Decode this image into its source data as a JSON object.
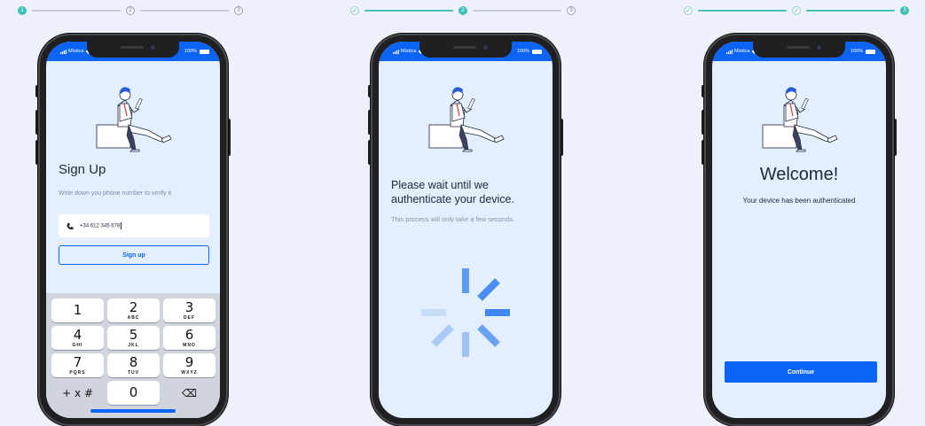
{
  "steppers": [
    {
      "steps": [
        {
          "label": "1",
          "state": "active"
        },
        {
          "label": "2",
          "state": "pending"
        },
        {
          "label": "3",
          "state": "pending"
        }
      ]
    },
    {
      "steps": [
        {
          "label": "✓",
          "state": "done"
        },
        {
          "label": "2",
          "state": "active"
        },
        {
          "label": "3",
          "state": "pending"
        }
      ]
    },
    {
      "steps": [
        {
          "label": "✓",
          "state": "done"
        },
        {
          "label": "✓",
          "state": "done"
        },
        {
          "label": "3",
          "state": "active"
        }
      ]
    }
  ],
  "status_bar": {
    "carrier": "Mística",
    "battery": "100%"
  },
  "signup_screen": {
    "title": "Sign Up",
    "subtitle": "Write down you phone number to verify it",
    "phone_value": "+34 612 345 678",
    "button_label": "Sign up",
    "keypad": [
      {
        "digit": "1",
        "letters": ""
      },
      {
        "digit": "2",
        "letters": "ABC"
      },
      {
        "digit": "3",
        "letters": "DEF"
      },
      {
        "digit": "4",
        "letters": "GHI"
      },
      {
        "digit": "5",
        "letters": "JKL"
      },
      {
        "digit": "6",
        "letters": "MNO"
      },
      {
        "digit": "7",
        "letters": "PQRS"
      },
      {
        "digit": "8",
        "letters": "TUV"
      },
      {
        "digit": "9",
        "letters": "WXYZ"
      },
      {
        "digit": "+ x #",
        "letters": ""
      },
      {
        "digit": "0",
        "letters": ""
      },
      {
        "digit": "⌫",
        "letters": ""
      }
    ]
  },
  "wait_screen": {
    "title": "Please wait until we authenticate your device.",
    "subtitle": "This process will only take a few seconds."
  },
  "welcome_screen": {
    "title": "Welcome!",
    "subtitle": "Your device has been authenticated",
    "button_label": "Continue"
  },
  "colors": {
    "brand": "#0b64f5",
    "teal": "#3fc1b7",
    "screen_bg": "#e3efff",
    "page_bg": "#eef1fb"
  },
  "icons": [
    "signal-icon",
    "wifi-icon",
    "battery-icon",
    "phone-icon",
    "backspace-icon",
    "check-icon",
    "spinner-icon"
  ]
}
